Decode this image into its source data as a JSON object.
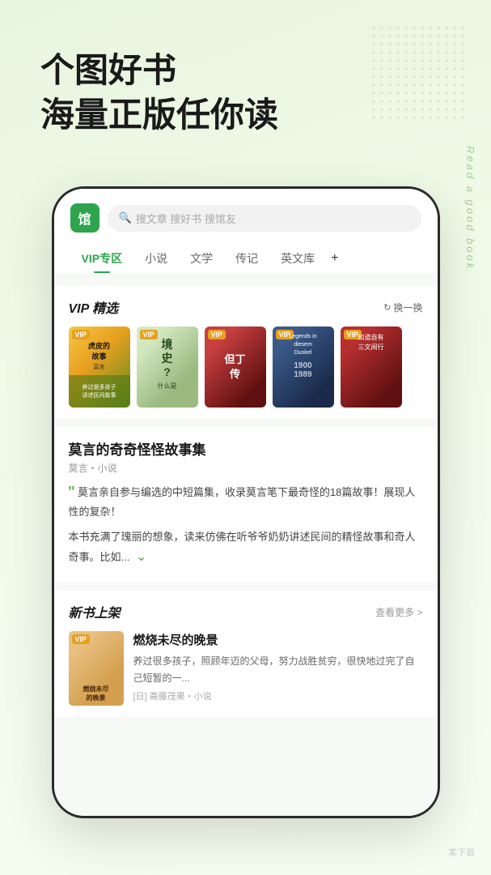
{
  "hero": {
    "line1": "个图好书",
    "line2": "海量正版任你读",
    "side_text": "Read a good book"
  },
  "app": {
    "logo_text": "馆",
    "search": {
      "placeholder": "搜文章 搜好书 搜馆友"
    },
    "nav": {
      "tabs": [
        {
          "label": "VIP专区",
          "active": true
        },
        {
          "label": "小说",
          "active": false
        },
        {
          "label": "文学",
          "active": false
        },
        {
          "label": "传记",
          "active": false
        },
        {
          "label": "英文库",
          "active": false
        }
      ],
      "plus_label": "+"
    },
    "vip_section": {
      "title": "VIP 精选",
      "action": "换一换",
      "books": [
        {
          "title": "虎皮的故事",
          "sub": "莫言",
          "badge": "VIP"
        },
        {
          "title": "境史?",
          "sub": "什么是",
          "badge": "VIP"
        },
        {
          "title": "但丁传",
          "sub": "",
          "badge": "VIP"
        },
        {
          "title": "Legends in diesem Dunkel 1900 1989",
          "sub": "",
          "badge": "VIP"
        },
        {
          "title": "知道自有三文阅行",
          "sub": "",
          "badge": "VIP"
        }
      ]
    },
    "feature_section": {
      "title": "莫言的奇奇怪怪故事集",
      "author": "莫言・小说",
      "desc1": "莫言亲自参与编选的中短篇集，收录莫言笔下最奇怪的18篇故事！展现人性的复杂！",
      "desc2": "本书充满了瑰丽的想象，读来仿佛在听爷爷奶奶讲述民间的精怪故事和奇人奇事。比如..."
    },
    "new_section": {
      "title": "新书上架",
      "see_more": "查看更多 >",
      "books": [
        {
          "title": "燃烧未尽的晚景",
          "desc": "养过很多孩子，照顾年迈的父母，努力战胜贫穷，很快地过完了自己短暂的一...",
          "meta": "[日] 斋藤茂果・小说",
          "badge": "VIP"
        }
      ]
    }
  },
  "watermark": "某下载"
}
